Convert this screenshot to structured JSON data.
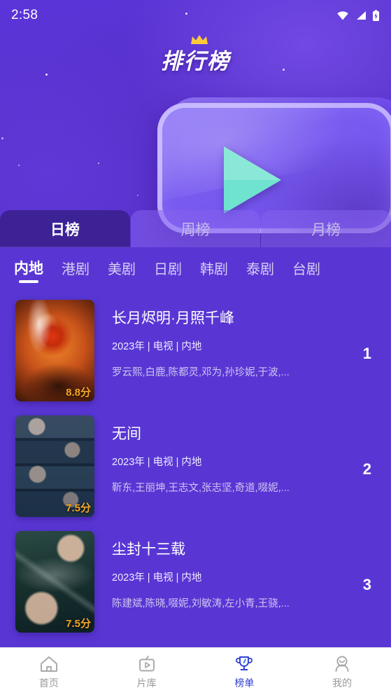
{
  "status_bar": {
    "time": "2:58",
    "icons": [
      "wifi-icon",
      "cellular-signal-icon",
      "battery-charging-icon"
    ]
  },
  "hero": {
    "title": "排行榜",
    "crown_icon": "crown-icon",
    "play_icon": "play-triangle-icon"
  },
  "period_tabs": [
    {
      "label": "日榜",
      "active": true
    },
    {
      "label": "周榜",
      "active": false
    },
    {
      "label": "月榜",
      "active": false
    }
  ],
  "category_tabs": [
    {
      "label": "内地",
      "active": true
    },
    {
      "label": "港剧",
      "active": false
    },
    {
      "label": "美剧",
      "active": false
    },
    {
      "label": "日剧",
      "active": false
    },
    {
      "label": "韩剧",
      "active": false
    },
    {
      "label": "泰剧",
      "active": false
    },
    {
      "label": "台剧",
      "active": false
    }
  ],
  "rank_list": [
    {
      "rank": "1",
      "title": "长月烬明·月照千峰",
      "meta": "2023年 | 电视 | 内地",
      "cast": "罗云熙,白鹿,陈都灵,邓为,孙珍妮,于波,...",
      "score": "8.8分",
      "poster_style": "art-fire"
    },
    {
      "rank": "2",
      "title": "无间",
      "meta": "2023年 | 电视 | 内地",
      "cast": "靳东,王丽坤,王志文,张志坚,奇道,啜妮,...",
      "score": "7.5分",
      "poster_style": "art-grid"
    },
    {
      "rank": "3",
      "title": "尘封十三载",
      "meta": "2023年 | 电视 | 内地",
      "cast": "陈建斌,陈晓,啜妮,刘敏涛,左小青,王骁,...",
      "score": "7.5分",
      "poster_style": "art-teal"
    }
  ],
  "bottom_nav": [
    {
      "label": "首页",
      "icon": "home-icon",
      "active": false
    },
    {
      "label": "片库",
      "icon": "tv-play-icon",
      "active": false
    },
    {
      "label": "榜单",
      "icon": "trophy-icon",
      "active": true
    },
    {
      "label": "我的",
      "icon": "person-icon",
      "active": false
    }
  ],
  "colors": {
    "background": "#5a34d6",
    "content_background": "#5936d4",
    "active_period_tab": "#3d2296",
    "score_text": "#f6a623",
    "nav_active": "#2f3fd4",
    "play_triangle": "#6fe3cf"
  }
}
